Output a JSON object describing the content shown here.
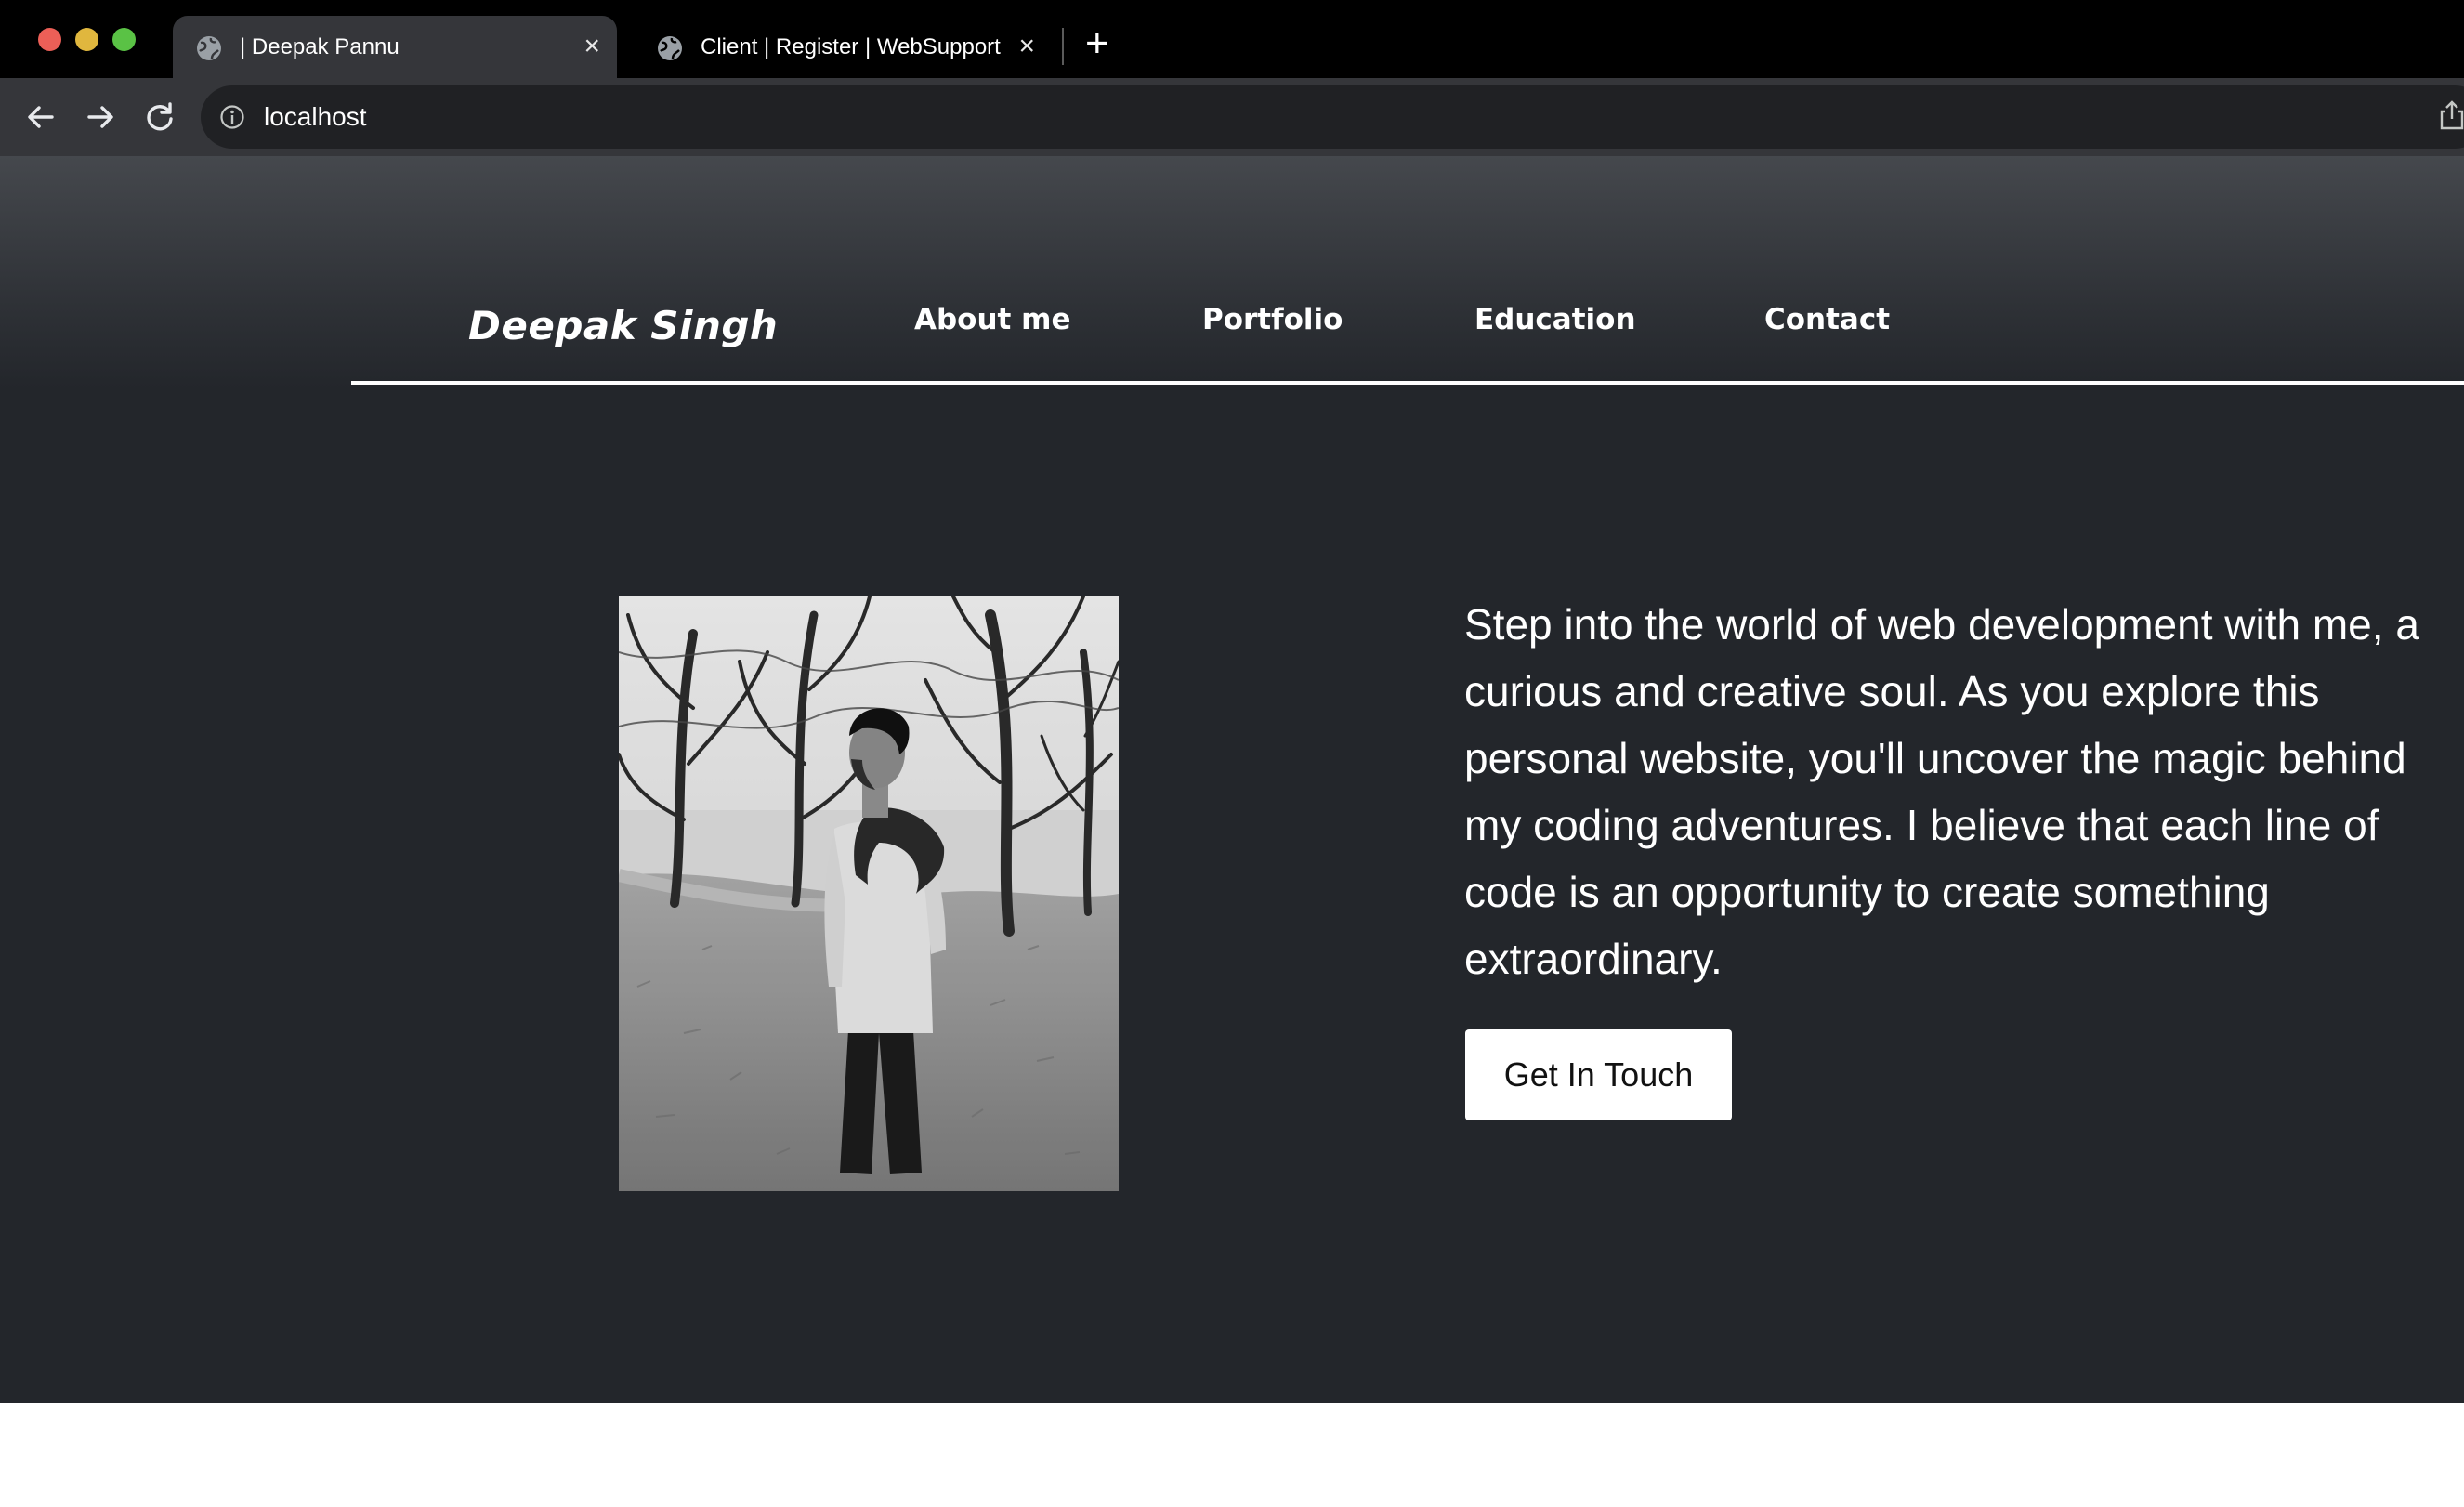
{
  "browser": {
    "tabs": [
      {
        "title": "| Deepak Pannu",
        "active": true
      },
      {
        "title": "Client | Register | WebSupport",
        "active": false
      }
    ],
    "new_tab_label": "+",
    "close_label": "×",
    "address": "localhost"
  },
  "site": {
    "brand": "Deepak Singh",
    "nav": [
      {
        "label": "About me"
      },
      {
        "label": "Portfolio"
      },
      {
        "label": "Education"
      },
      {
        "label": "Contact"
      }
    ],
    "hero": {
      "intro": "Step into the world of web development with me, a curious and creative soul. As you explore this personal website, you'll uncover the magic behind my coding adventures. I believe that each line of code is an opportunity to create something extraordinary.",
      "cta_label": "Get In Touch"
    }
  },
  "colors": {
    "page_background": "#23262b",
    "header_gradient_top": "#45484d",
    "text": "#ffffff",
    "cta_background": "#ffffff",
    "cta_text": "#111111"
  },
  "icons": [
    "globe-icon",
    "close-icon",
    "plus-icon",
    "back-arrow-icon",
    "forward-arrow-icon",
    "reload-icon",
    "info-icon",
    "share-icon"
  ]
}
